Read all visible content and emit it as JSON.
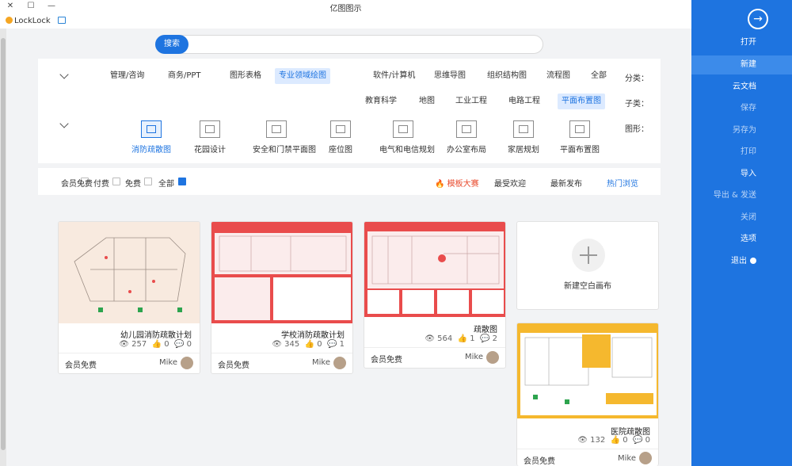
{
  "window": {
    "title": "亿图图示",
    "min": "—",
    "max": "☐",
    "close": "✕"
  },
  "user": {
    "name": "LockLock"
  },
  "sidebar": {
    "items": [
      {
        "label": "打开",
        "state": "normal"
      },
      {
        "label": "新建",
        "state": "active"
      },
      {
        "label": "云文档",
        "state": "normal"
      },
      {
        "label": "保存",
        "state": "dim"
      },
      {
        "label": "另存为",
        "state": "dim"
      },
      {
        "label": "打印",
        "state": "dim"
      },
      {
        "label": "导入",
        "state": "normal"
      },
      {
        "label": "导出 & 发送",
        "state": "dim"
      },
      {
        "label": "关闭",
        "state": "dim"
      },
      {
        "label": "选项",
        "state": "normal"
      },
      {
        "label": "退出",
        "state": "normal"
      }
    ]
  },
  "search": {
    "button": "搜索",
    "placeholder": ""
  },
  "filters": {
    "category_label": "分类：",
    "categories": [
      "全部",
      "流程图",
      "组织结构图",
      "思维导图",
      "软件/计算机",
      "专业领域绘图",
      "图形表格",
      "商务/PPT",
      "管理/咨询"
    ],
    "sub_label": "子类：",
    "subs": [
      "平面布置图",
      "电路工程",
      "工业工程",
      "地图",
      "教育科学"
    ],
    "shape_label": "图形：",
    "shapes": [
      "平面布置图",
      "家居规划",
      "办公室布局",
      "电气和电信规划",
      "座位图",
      "安全和门禁平面图",
      "花园设计",
      "消防疏散图"
    ]
  },
  "sortbar": {
    "sorts": [
      "热门浏览",
      "最新发布",
      "最受欢迎",
      "模板大赛"
    ],
    "pay": [
      "全部",
      "免费",
      "付费",
      "会员免费"
    ]
  },
  "new_blank": "新建空白画布",
  "cards": [
    {
      "title": "疏散图",
      "views": "564",
      "likes": "1",
      "comments": "2",
      "author": "Mike",
      "price": "会员免费"
    },
    {
      "title": "学校消防疏散计划",
      "views": "345",
      "likes": "0",
      "comments": "1",
      "author": "Mike",
      "price": "会员免费"
    },
    {
      "title": "幼儿园消防疏散计划",
      "views": "257",
      "likes": "0",
      "comments": "0",
      "author": "Mike",
      "price": "会员免费"
    },
    {
      "title": "医院疏散图",
      "views": "132",
      "likes": "0",
      "comments": "0",
      "author": "Mike",
      "price": "会员免费"
    }
  ]
}
